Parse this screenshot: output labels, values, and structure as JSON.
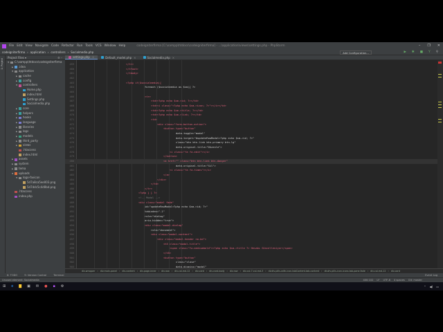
{
  "menubar": {
    "items": [
      "File",
      "Edit",
      "View",
      "Navigate",
      "Code",
      "Refactor",
      "Run",
      "Tools",
      "VCS",
      "Window",
      "Help"
    ],
    "title": "codeigniterfirma [C:\\xampp\\htdocs\\codeigniterfirma] - ...\\application\\views\\settings.php - PhpStorm"
  },
  "navbar": {
    "crumbs": [
      "codeigniterfirma",
      "›",
      "application",
      "›",
      "controllers",
      "›",
      "Socialmedia.php"
    ],
    "add_config": "Add Configuration..."
  },
  "left_strip": {
    "project_label": "1: Project"
  },
  "project": {
    "header": "Project Files ▾",
    "tree": [
      {
        "d": 0,
        "a": "▼",
        "label": "C:\\xampp\\htdocs\\codeigniterfirma",
        "c": "#8a8a8a"
      },
      {
        "d": 1,
        "a": "▶",
        "label": ".idea",
        "c": "#5a9bd5"
      },
      {
        "d": 1,
        "a": "▼",
        "label": "application",
        "c": "#8a8a8a"
      },
      {
        "d": 2,
        "a": "▶",
        "label": "cache",
        "c": "#8a8a8a"
      },
      {
        "d": 2,
        "a": "▶",
        "label": "config",
        "c": "#3aa0a0"
      },
      {
        "d": 2,
        "a": "▼",
        "label": "controllers",
        "c": "#c05090"
      },
      {
        "d": 3,
        "a": "",
        "label": "Home.php",
        "c": "#2ea0d0"
      },
      {
        "d": 3,
        "a": "",
        "label": "index.html",
        "c": "#c0a060"
      },
      {
        "d": 3,
        "a": "",
        "label": "Settings.php",
        "c": "#2ea0d0"
      },
      {
        "d": 3,
        "a": "",
        "label": "Socialmedia.php",
        "c": "#2ea0d0"
      },
      {
        "d": 2,
        "a": "▶",
        "label": "core",
        "c": "#3aa0a0"
      },
      {
        "d": 2,
        "a": "▶",
        "label": "helpers",
        "c": "#3aa0a0"
      },
      {
        "d": 2,
        "a": "▶",
        "label": "hooks",
        "c": "#7a7ad0"
      },
      {
        "d": 2,
        "a": "▶",
        "label": "language",
        "c": "#7a7ad0"
      },
      {
        "d": 2,
        "a": "▶",
        "label": "libraries",
        "c": "#8a8a8a"
      },
      {
        "d": 2,
        "a": "▶",
        "label": "logs",
        "c": "#8a8a8a"
      },
      {
        "d": 2,
        "a": "▶",
        "label": "models",
        "c": "#3aa080"
      },
      {
        "d": 2,
        "a": "▶",
        "label": "third_party",
        "c": "#8a8a8a"
      },
      {
        "d": 2,
        "a": "▶",
        "label": "views",
        "c": "#d0a030"
      },
      {
        "d": 2,
        "a": "",
        "label": ".htaccess",
        "c": "#c05050"
      },
      {
        "d": 2,
        "a": "",
        "label": "index.html",
        "c": "#c0a060"
      },
      {
        "d": 1,
        "a": "▶",
        "label": "assets",
        "c": "#a050c0"
      },
      {
        "d": 1,
        "a": "▶",
        "label": "system",
        "c": "#8a8a8a"
      },
      {
        "d": 1,
        "a": "▶",
        "label": "tema",
        "c": "#8a8a8a"
      },
      {
        "d": 1,
        "a": "▼",
        "label": "uploads",
        "c": "#e07040"
      },
      {
        "d": 2,
        "a": "▼",
        "label": "logo-favicon",
        "c": "#8a8a8a"
      },
      {
        "d": 3,
        "a": "",
        "label": "5d7a8ca5ee003.png",
        "c": "#c0a060"
      },
      {
        "d": 3,
        "a": "",
        "label": "5d7ddc5c4d0bd.png",
        "c": "#c0a060"
      },
      {
        "d": 1,
        "a": "",
        "label": ".htaccess",
        "c": "#c05050"
      },
      {
        "d": 1,
        "a": "",
        "label": "index.php",
        "c": "#a050c0"
      }
    ]
  },
  "tabs": [
    {
      "label": "settings.php",
      "active": true,
      "color": "#c05090"
    },
    {
      "label": "Default_model.php",
      "active": false,
      "color": "#2ea0d0"
    },
    {
      "label": "Socialmedia.php",
      "active": false,
      "color": "#2ea0d0"
    }
  ],
  "editor": {
    "first_line": 459,
    "current_line": 480,
    "lines": [
      [
        0,
        "</tr>"
      ],
      [
        0,
        "</tfoot>"
      ],
      [
        0,
        "</tbody>"
      ],
      [
        0,
        ""
      ],
      [
        0,
        "<?php if($socialmedia){"
      ],
      [
        3,
        "foreach ($socialmedia as $sm){ ?>"
      ],
      [
        0,
        ""
      ],
      [
        3,
        "<tr>"
      ],
      [
        4,
        "<td><?php echo $sm->id; ?></td>"
      ],
      [
        4,
        "<td><i class=\"<?php echo $sm->icon; ?>\"></i></td>"
      ],
      [
        4,
        "<td><?php echo $sm->title; ?></td>"
      ],
      [
        4,
        "<td><?php echo $sm->link; ?></td>"
      ],
      [
        4,
        "<td>"
      ],
      [
        5,
        "<div class=\"form-button-action\">"
      ],
      [
        6,
        "<button type=\"button\""
      ],
      [
        8,
        "data-toggle=\"modal\""
      ],
      [
        8,
        "data-target=\"#updateRowModal<?php echo $sm->id; ?>\""
      ],
      [
        8,
        "class=\"btn btn-link btn-primary btn-lg\""
      ],
      [
        8,
        "data-original-title=\"Düzenle\">"
      ],
      [
        7,
        "<i class=\"fa fa-edit\"></i>"
      ],
      [
        6,
        "</button>"
      ],
      [
        6,
        "<a href=\"\" class=\"btn btn-link btn-danger\""
      ],
      [
        8,
        "data-original-title=\"Sil\">"
      ],
      [
        7,
        "<i class=\"fa fa-times\"></i>"
      ],
      [
        6,
        "</a>"
      ],
      [
        5,
        "</div>"
      ],
      [
        4,
        "</td>"
      ],
      [
        3,
        "</tr>"
      ],
      [
        2,
        "<?php } } ?>"
      ],
      [
        2,
        "<!-- Modal -->"
      ],
      [
        2,
        "<div class=\"modal fade\""
      ],
      [
        3,
        "id=\"updateRowModal<?php echo $sm->id; ?>\""
      ],
      [
        3,
        "tabindex=\"-1\""
      ],
      [
        3,
        "role=\"dialog\""
      ],
      [
        3,
        "aria-hidden=\"true\">"
      ],
      [
        3,
        "<div class=\"modal-dialog\""
      ],
      [
        4,
        "role=\"document\">"
      ],
      [
        4,
        "<div class=\"modal-content\">"
      ],
      [
        5,
        "<div class=\"modal-header no-bd\">"
      ],
      [
        6,
        "<h5 class=\"modal-title\">"
      ],
      [
        7,
        "<span class=\"fw-mediumbold\"><?php echo $sm->title ?> Hesabı Güncelleniyor</span>"
      ],
      [
        6,
        "</h5>"
      ],
      [
        6,
        "<button type=\"button\""
      ],
      [
        8,
        "class=\"close\""
      ],
      [
        8,
        "data-dismiss=\"modal\""
      ]
    ]
  },
  "editor_breadcrumb": [
    "div.wrapper",
    "›",
    "div.main-panel",
    "›",
    "div.content",
    "›",
    "div.page-inner",
    "›",
    "div.row",
    "›",
    "div.col-md-12",
    "›",
    "div.card",
    "›",
    "div.card-body",
    "›",
    "div.row",
    "›",
    "div.col-7.col-md-3",
    "›",
    "div#v-pills-with-icon-tabContent.tab-content",
    "›",
    "div#v-pills-icon-icons.tab-pane.fade",
    "›",
    "div.col-md-12",
    "›",
    "div.card"
  ],
  "toolwindows": {
    "todo": "6: TODO",
    "vcs": "9: Version Control",
    "terminal": "Terminal",
    "event_log": "Event Log"
  },
  "status": {
    "message": "Unused element: Socialmedia",
    "position": "400:102",
    "line_sep": "LF",
    "encoding": "UTF-8",
    "indent": "4 spaces",
    "git": "Git: master"
  }
}
